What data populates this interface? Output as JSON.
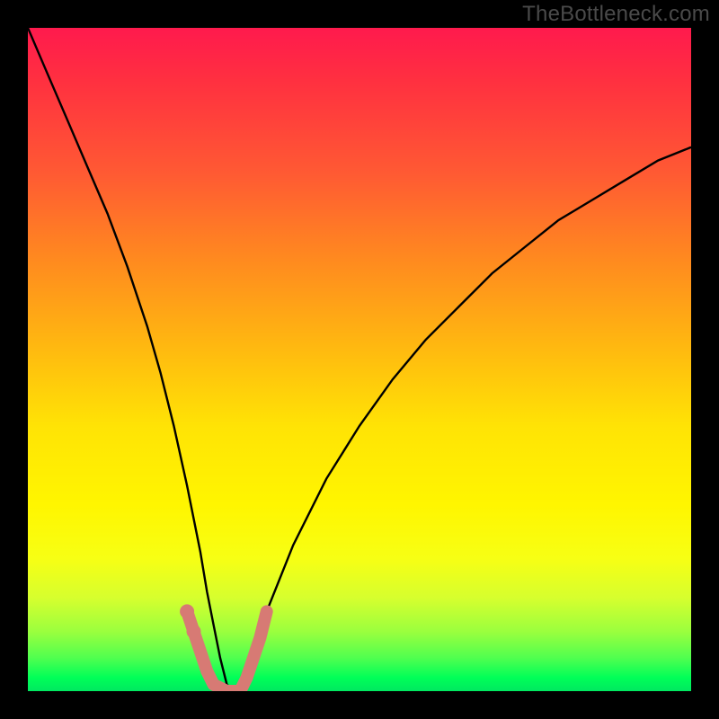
{
  "watermark": "TheBottleneck.com",
  "chart_data": {
    "type": "line",
    "title": "",
    "xlabel": "",
    "ylabel": "",
    "xlim": [
      0,
      100
    ],
    "ylim": [
      0,
      100
    ],
    "background": {
      "type": "vertical-gradient",
      "stops": [
        {
          "pos": 0,
          "color": "#ff1a4d"
        },
        {
          "pos": 50,
          "color": "#ffe305"
        },
        {
          "pos": 100,
          "color": "#00e860"
        }
      ]
    },
    "series": [
      {
        "name": "bottleneck-curve",
        "description": "V-shaped bottleneck curve; y-value represents bottleneck severity (high=red top, low=green bottom). Minimum near x≈30.",
        "x": [
          0,
          3,
          6,
          9,
          12,
          15,
          18,
          20,
          22,
          24,
          26,
          27,
          28,
          29,
          30,
          31,
          32,
          33,
          34,
          36,
          40,
          45,
          50,
          55,
          60,
          65,
          70,
          75,
          80,
          85,
          90,
          95,
          100
        ],
        "y": [
          100,
          93,
          86,
          79,
          72,
          64,
          55,
          48,
          40,
          31,
          21,
          15,
          10,
          5,
          1,
          0,
          1,
          3,
          6,
          12,
          22,
          32,
          40,
          47,
          53,
          58,
          63,
          67,
          71,
          74,
          77,
          80,
          82
        ]
      }
    ],
    "markers": {
      "name": "highlight-band",
      "description": "Salmon-colored thick overlay near curve minimum (approx x 24–36, y 0–12).",
      "color": "#d77a74",
      "points": [
        {
          "x": 24,
          "y": 12
        },
        {
          "x": 25,
          "y": 9
        },
        {
          "x": 27,
          "y": 3
        },
        {
          "x": 28,
          "y": 1
        },
        {
          "x": 30,
          "y": 0
        },
        {
          "x": 32,
          "y": 0
        },
        {
          "x": 33,
          "y": 2
        },
        {
          "x": 34,
          "y": 5
        },
        {
          "x": 35,
          "y": 8
        },
        {
          "x": 36,
          "y": 12
        }
      ]
    }
  }
}
